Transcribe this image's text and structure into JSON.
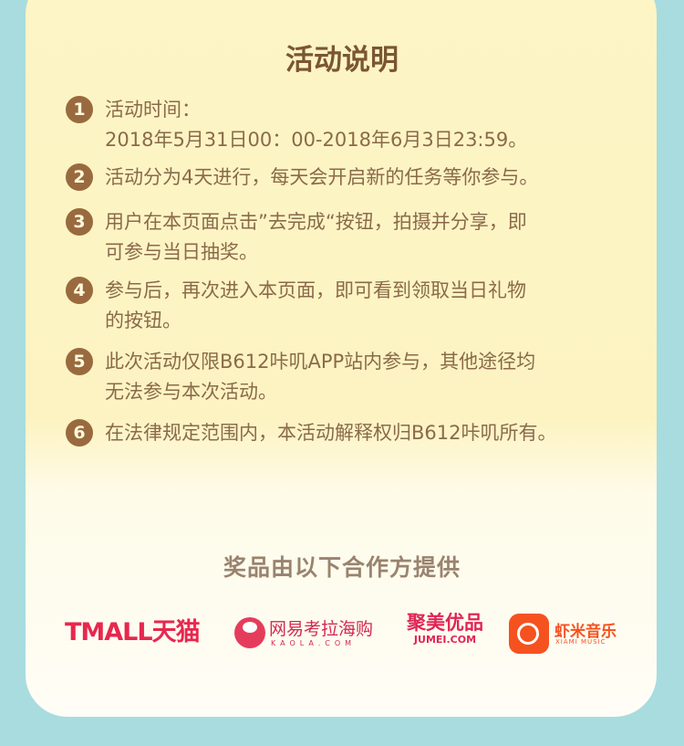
{
  "title": "活动说明",
  "rules": [
    {
      "num": "1",
      "text": "活动时间：\n2018年5月31日00：00-2018年6月3日23:59。"
    },
    {
      "num": "2",
      "text": "活动分为4天进行，每天会开启新的任务等你参与。"
    },
    {
      "num": "3",
      "text": "用户在本页面点击”去完成“按钮，拍摄并分享，即\n可参与当日抽奖。"
    },
    {
      "num": "4",
      "text": "参与后，再次进入本页面，即可看到领取当日礼物\n的按钮。"
    },
    {
      "num": "5",
      "text": "此次活动仅限B612咔叽APP站内参与，其他途径均\n无法参与本次活动。"
    },
    {
      "num": "6",
      "text": "在法律规定范围内，本活动解释权归B612咔叽所有。"
    }
  ],
  "sponsor_title": "奖品由以下合作方提供",
  "sponsors": {
    "tmall": "TMALL天猫",
    "kaola": {
      "name": "网易考拉海购",
      "sub": "KAOLA.COM"
    },
    "jumei": {
      "name": "聚美优品",
      "sub": "JUMEI.COM"
    },
    "xiami": {
      "name": "虾米音乐",
      "sub": "XIAMI MUSIC"
    }
  },
  "colors": {
    "background": "#a8dcdf",
    "card": "#fdf5c6",
    "accent": "#9a6a3f",
    "text": "#8a6a4a"
  }
}
